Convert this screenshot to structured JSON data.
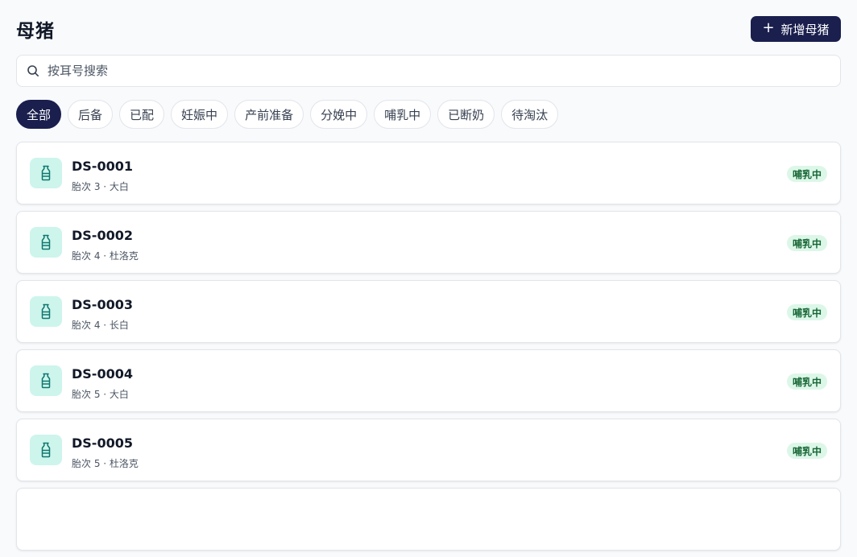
{
  "header": {
    "title": "母猪",
    "add_button_label": "新增母猪"
  },
  "search": {
    "placeholder": "按耳号搜索",
    "value": ""
  },
  "filters": [
    {
      "label": "全部",
      "active": true
    },
    {
      "label": "后备",
      "active": false
    },
    {
      "label": "已配",
      "active": false
    },
    {
      "label": "妊娠中",
      "active": false
    },
    {
      "label": "产前准备",
      "active": false
    },
    {
      "label": "分娩中",
      "active": false
    },
    {
      "label": "哺乳中",
      "active": false
    },
    {
      "label": "已断奶",
      "active": false
    },
    {
      "label": "待淘汰",
      "active": false
    }
  ],
  "sows": [
    {
      "code": "DS-0001",
      "meta": "胎次 3 · 大白",
      "status": "哺乳中"
    },
    {
      "code": "DS-0002",
      "meta": "胎次 4 · 杜洛克",
      "status": "哺乳中"
    },
    {
      "code": "DS-0003",
      "meta": "胎次 4 · 长白",
      "status": "哺乳中"
    },
    {
      "code": "DS-0004",
      "meta": "胎次 5 · 大白",
      "status": "哺乳中"
    },
    {
      "code": "DS-0005",
      "meta": "胎次 5 · 杜洛克",
      "status": "哺乳中"
    },
    {
      "code": "",
      "meta": "",
      "status": ""
    }
  ],
  "icons": {
    "search": "search-icon",
    "add": "plus-icon",
    "sow": "milk-bottle-icon"
  },
  "colors": {
    "primary": "#1a1f4e",
    "icon_bg": "#cdf5ec",
    "icon_fg": "#0f766e",
    "badge_bg": "#dcf7e8",
    "badge_fg": "#166534"
  }
}
